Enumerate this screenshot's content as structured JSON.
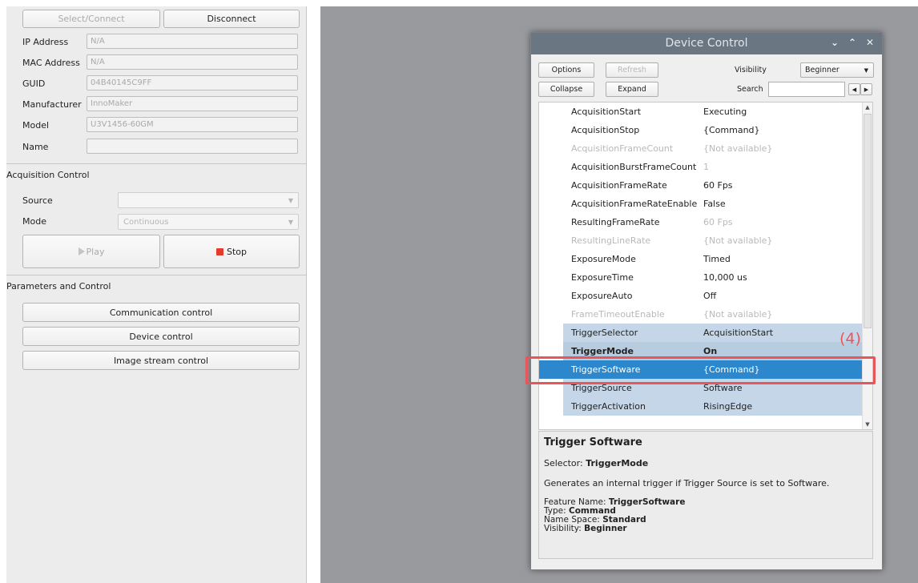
{
  "connection": {
    "select_connect": "Select/Connect",
    "disconnect": "Disconnect",
    "fields": [
      {
        "label": "IP Address",
        "value": "N/A"
      },
      {
        "label": "MAC Address",
        "value": "N/A"
      },
      {
        "label": "GUID",
        "value": "04B40145C9FF"
      },
      {
        "label": "Manufacturer",
        "value": "InnoMaker"
      },
      {
        "label": "Model",
        "value": "U3V1456-60GM"
      },
      {
        "label": "Name",
        "value": ""
      }
    ]
  },
  "acquisition": {
    "title": "Acquisition Control",
    "source_label": "Source",
    "source_value": "",
    "mode_label": "Mode",
    "mode_value": "Continuous",
    "play": "Play",
    "stop": "Stop"
  },
  "parameters": {
    "title": "Parameters and Control",
    "buttons": [
      "Communication control",
      "Device control",
      "Image stream control"
    ]
  },
  "dialog": {
    "title": "Device Control",
    "options": "Options",
    "refresh": "Refresh",
    "visibility_label": "Visibility",
    "visibility_value": "Beginner",
    "collapse": "Collapse",
    "expand": "Expand",
    "search_label": "Search",
    "search_value": "",
    "rows": [
      {
        "name": "AcquisitionStart",
        "value": "Executing",
        "style": ""
      },
      {
        "name": "AcquisitionStop",
        "value": "{Command}",
        "style": ""
      },
      {
        "name": "AcquisitionFrameCount",
        "value": "{Not available}",
        "style": "grey"
      },
      {
        "name": "AcquisitionBurstFrameCount",
        "value": "1",
        "style": "vgrey"
      },
      {
        "name": "AcquisitionFrameRate",
        "value": "60 Fps",
        "style": ""
      },
      {
        "name": "AcquisitionFrameRateEnable",
        "value": "False",
        "style": ""
      },
      {
        "name": "ResultingFrameRate",
        "value": "60 Fps",
        "style": "vgrey"
      },
      {
        "name": "ResultingLineRate",
        "value": "{Not available}",
        "style": "grey"
      },
      {
        "name": "ExposureMode",
        "value": "Timed",
        "style": ""
      },
      {
        "name": "ExposureTime",
        "value": "10,000 us",
        "style": ""
      },
      {
        "name": "ExposureAuto",
        "value": "Off",
        "style": ""
      },
      {
        "name": "FrameTimeoutEnable",
        "value": "{Not available}",
        "style": "grey"
      },
      {
        "name": "TriggerSelector",
        "value": "AcquisitionStart",
        "style": "bluebg"
      },
      {
        "name": "TriggerMode",
        "value": "On",
        "style": "bluebg2 bold"
      },
      {
        "name": "TriggerSoftware",
        "value": "{Command}",
        "style": "selected"
      },
      {
        "name": "TriggerSource",
        "value": "Software",
        "style": "bluebg"
      },
      {
        "name": "TriggerActivation",
        "value": "RisingEdge",
        "style": "bluebg"
      }
    ],
    "description": {
      "heading": "Trigger Software",
      "selector_label": "Selector:",
      "selector_value": "TriggerMode",
      "text": "Generates an internal trigger if Trigger Source is set to Software.",
      "feature_name_label": "Feature Name:",
      "feature_name_value": "TriggerSoftware",
      "type_label": "Type:",
      "type_value": "Command",
      "namespace_label": "Name Space:",
      "namespace_value": "Standard",
      "visibility_label": "Visibility:",
      "visibility_value": "Beginner"
    }
  },
  "annotation": {
    "label": "(4)",
    "color": "#e8565a"
  },
  "colors": {
    "selected_row": "#2d87cd",
    "stop_icon": "#e43c2c",
    "titlebar": "#6a7681"
  }
}
